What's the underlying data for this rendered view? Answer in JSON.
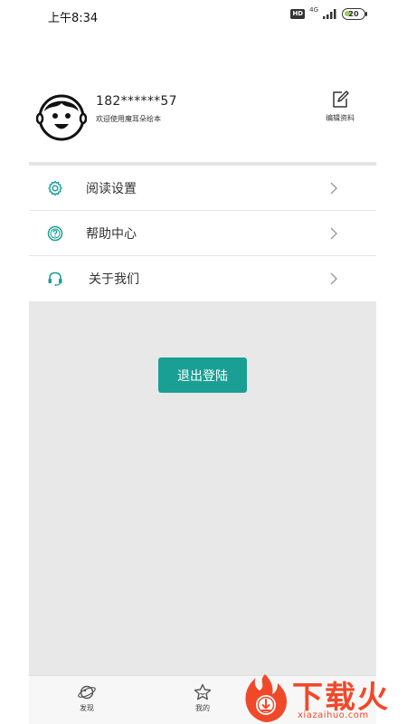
{
  "status_bar": {
    "time": "上午8:34",
    "hd": "HD",
    "network": "4G",
    "battery": "20"
  },
  "profile": {
    "phone": "182******57",
    "welcome": "欢迎使用魔耳朵绘本",
    "edit_label": "编辑资料"
  },
  "menu": {
    "items": [
      {
        "label": "阅读设置",
        "icon": "gear-icon"
      },
      {
        "label": "帮助中心",
        "icon": "help-icon"
      },
      {
        "label": "关于我们",
        "icon": "headset-icon"
      }
    ]
  },
  "logout_label": "退出登陆",
  "tabbar": {
    "tabs": [
      {
        "label": "发现",
        "icon": "planet-icon"
      },
      {
        "label": "我的",
        "icon": "star-icon"
      }
    ]
  },
  "watermark": {
    "title": "下载火",
    "url": "xiazaihuo.com"
  },
  "colors": {
    "accent": "#1a9f94",
    "background_gray": "#e8e8e8",
    "watermark": "#f0492a"
  }
}
